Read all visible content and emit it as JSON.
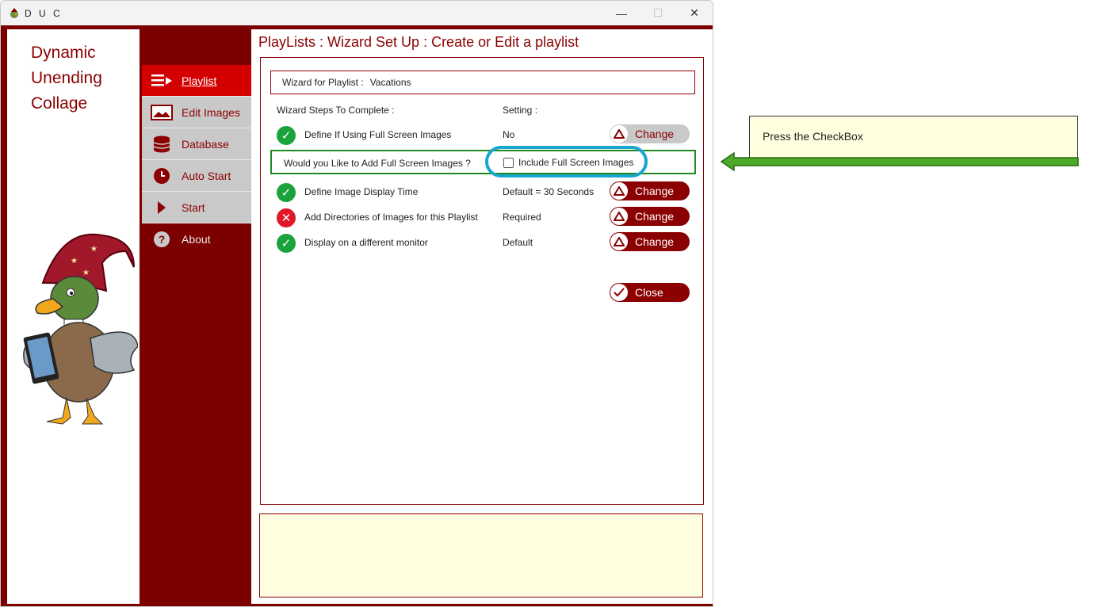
{
  "window": {
    "title": "D U C",
    "minimize": "—",
    "maximize": "☐",
    "close": "✕"
  },
  "brand": {
    "line1": "Dynamic",
    "line2": "Unending",
    "line3": "Collage"
  },
  "nav": {
    "items": [
      {
        "label": "Playlist",
        "icon": "playlist-icon"
      },
      {
        "label": "Edit Images",
        "icon": "image-icon"
      },
      {
        "label": "Database",
        "icon": "database-icon"
      },
      {
        "label": "Auto Start",
        "icon": "clock-icon"
      },
      {
        "label": "Start",
        "icon": "play-icon"
      },
      {
        "label": "About",
        "icon": "help-icon"
      }
    ]
  },
  "page": {
    "title": "PlayLists : Wizard Set Up : Create or Edit a playlist"
  },
  "wizard": {
    "playlist_label": "Wizard for Playlist :",
    "playlist_name": "Vacations",
    "steps_header": "Wizard Steps To Complete :",
    "setting_header": "Setting :",
    "full_screen_question": "Would you Like to Add Full Screen Images ?",
    "full_screen_checkbox_label": "Include Full Screen Images",
    "steps": [
      {
        "label": "Define If Using Full Screen Images",
        "setting": "No",
        "status": "ok",
        "button": "Change"
      },
      {
        "label": "Define Image Display Time",
        "setting": "Default = 30 Seconds",
        "status": "ok",
        "button": "Change"
      },
      {
        "label": "Add Directories of Images for this Playlist",
        "setting": "Required",
        "status": "fail",
        "button": "Change"
      },
      {
        "label": "Display on a different monitor",
        "setting": "Default",
        "status": "ok",
        "button": "Change"
      }
    ],
    "close_button": "Close"
  },
  "callout": {
    "text": "Press the CheckBox"
  },
  "colors": {
    "brand_red": "#8b0000",
    "frame_red": "#7d0000",
    "active_red": "#d40000",
    "ok_green": "#1aa33a",
    "fail_red": "#e0182a",
    "highlight_cyan": "#18a6cf",
    "note_yellow": "#ffffe0"
  }
}
